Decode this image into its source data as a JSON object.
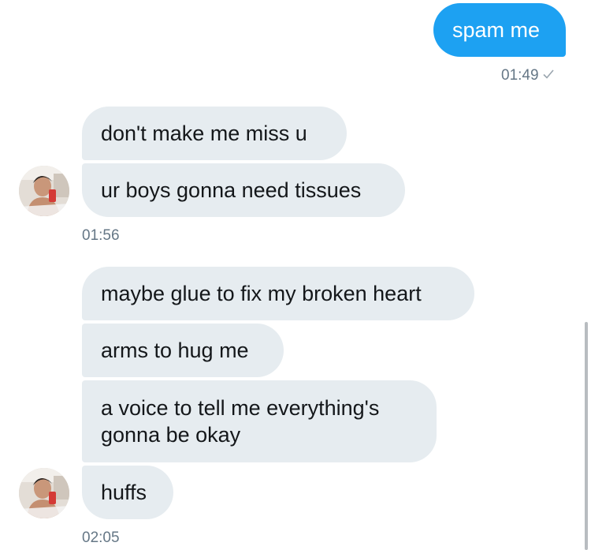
{
  "outgoing": {
    "message": "spam me",
    "time": "01:49",
    "status_icon": "sent-check-icon"
  },
  "group1": {
    "messages": [
      "don't make me miss u",
      "ur boys gonna need tissues"
    ],
    "time": "01:56"
  },
  "group2": {
    "messages": [
      "maybe glue to fix my broken heart",
      "arms to hug me",
      "a voice to tell me everything's gonna be okay",
      "huffs"
    ],
    "time": "02:05"
  },
  "colors": {
    "outgoing_bubble": "#1da1f2",
    "incoming_bubble": "#e6ecf0",
    "timestamp": "#657786"
  }
}
